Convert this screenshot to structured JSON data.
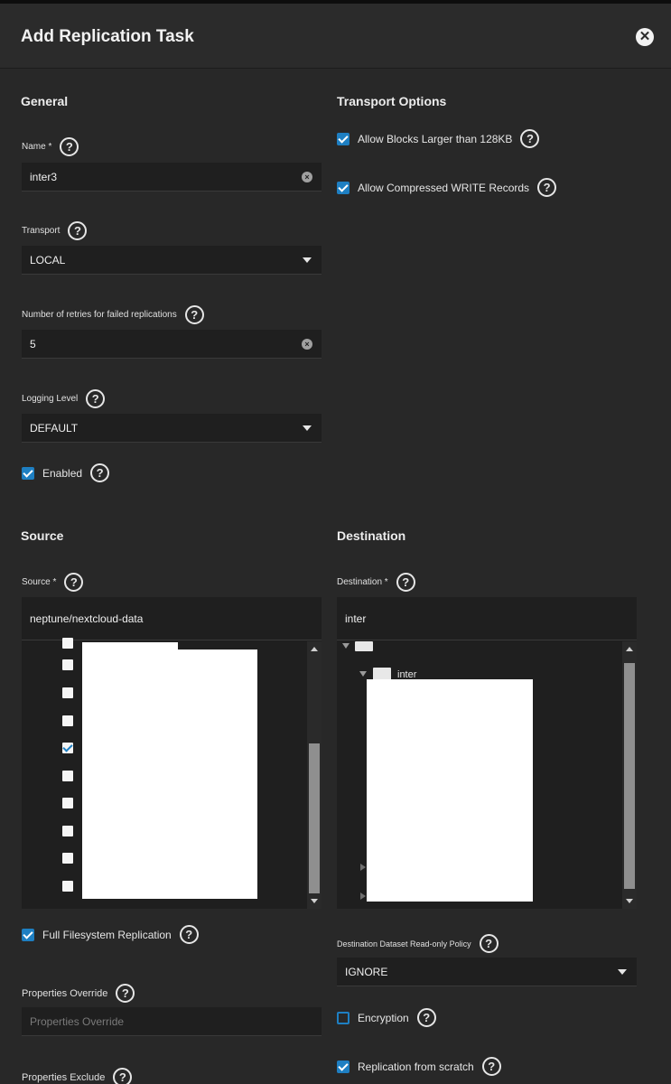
{
  "header": {
    "title": "Add Replication Task",
    "close_icon": "close-icon"
  },
  "general": {
    "title": "General",
    "name_label": "Name *",
    "name_value": "inter3",
    "transport_label": "Transport",
    "transport_value": "LOCAL",
    "retries_label": "Number of retries for failed replications",
    "retries_value": "5",
    "logging_label": "Logging Level",
    "logging_value": "DEFAULT",
    "enabled_label": "Enabled",
    "enabled_checked": true
  },
  "transport_options": {
    "title": "Transport Options",
    "large_blocks_label": "Allow Blocks Larger than 128KB",
    "large_blocks_checked": true,
    "compressed_label": "Allow Compressed WRITE Records",
    "compressed_checked": true
  },
  "source": {
    "title": "Source",
    "source_label": "Source *",
    "source_value": "neptune/nextcloud-data",
    "tree_checked": [
      false,
      false,
      false,
      false,
      true,
      false,
      false,
      false,
      false,
      false
    ],
    "full_fs_label": "Full Filesystem Replication",
    "full_fs_checked": true,
    "props_override_label": "Properties Override",
    "props_override_placeholder": "Properties Override",
    "props_exclude_label": "Properties Exclude"
  },
  "destination": {
    "title": "Destination",
    "destination_label": "Destination *",
    "destination_value": "inter",
    "tree_node_label": "inter",
    "readonly_policy_label": "Destination Dataset Read-only Policy",
    "readonly_policy_value": "IGNORE",
    "encryption_label": "Encryption",
    "encryption_checked": false,
    "scratch_label": "Replication from scratch",
    "scratch_checked": true
  },
  "icons": {
    "help": "help-icon",
    "clear": "clear-icon",
    "dropdown": "chevron-down-icon"
  },
  "colors": {
    "accent": "#1e7fc2",
    "background": "#282828",
    "field": "#1f1f1f"
  }
}
